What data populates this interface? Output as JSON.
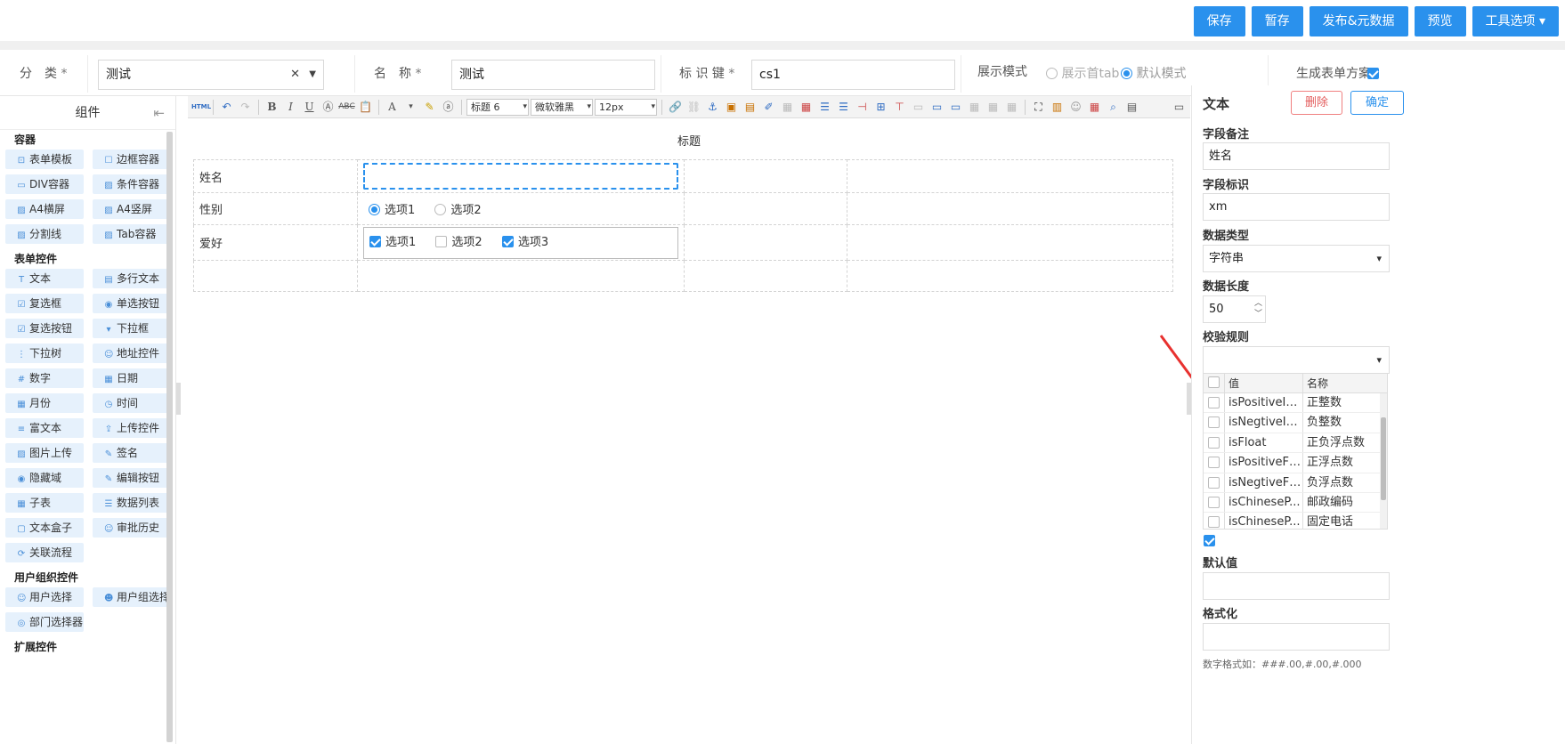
{
  "toolbar": {
    "buttons": [
      "保存",
      "暂存",
      "发布&元数据",
      "预览",
      "工具选项 ▾"
    ]
  },
  "meta": {
    "category_label": "分　类",
    "category_value": "测试",
    "name_label": "名　称",
    "name_value": "测试",
    "key_label": "标 识 键",
    "key_value": "cs1",
    "required_mark": "*",
    "display_mode_label": "展示模式",
    "display_mode_options": [
      "展示首tab",
      "默认模式"
    ],
    "display_mode_selected": "默认模式",
    "generate_scheme_label": "生成表单方案",
    "generate_scheme_checked": true
  },
  "left_panel": {
    "title": "组件",
    "groups": [
      {
        "title": "容器",
        "items": [
          {
            "icon": "html-icon",
            "label": "表单模板"
          },
          {
            "icon": "square-icon",
            "label": "边框容器"
          },
          {
            "icon": "div-icon",
            "label": "DIV容器"
          },
          {
            "icon": "image-icon",
            "label": "条件容器"
          },
          {
            "icon": "image-icon",
            "label": "A4横屏"
          },
          {
            "icon": "image-icon",
            "label": "A4竖屏"
          },
          {
            "icon": "image-icon",
            "label": "分割线"
          },
          {
            "icon": "image-icon",
            "label": "Tab容器"
          }
        ]
      },
      {
        "title": "表单控件",
        "items": [
          {
            "icon": "text-icon",
            "label": "文本"
          },
          {
            "icon": "textarea-icon",
            "label": "多行文本"
          },
          {
            "icon": "checkbox-icon",
            "label": "复选框"
          },
          {
            "icon": "radio-icon",
            "label": "单选按钮"
          },
          {
            "icon": "checkbox-icon",
            "label": "复选按钮"
          },
          {
            "icon": "dropdown-icon",
            "label": "下拉框"
          },
          {
            "icon": "tree-icon",
            "label": "下拉树"
          },
          {
            "icon": "user-icon",
            "label": "地址控件"
          },
          {
            "icon": "number-icon",
            "label": "数字"
          },
          {
            "icon": "calendar-icon",
            "label": "日期"
          },
          {
            "icon": "calendar-icon",
            "label": "月份"
          },
          {
            "icon": "clock-icon",
            "label": "时间"
          },
          {
            "icon": "richtext-icon",
            "label": "富文本"
          },
          {
            "icon": "upload-icon",
            "label": "上传控件"
          },
          {
            "icon": "image-icon",
            "label": "图片上传"
          },
          {
            "icon": "pen-icon",
            "label": "签名"
          },
          {
            "icon": "eye-icon",
            "label": "隐藏域"
          },
          {
            "icon": "edit-icon",
            "label": "编辑按钮"
          },
          {
            "icon": "table-icon",
            "label": "子表"
          },
          {
            "icon": "list-icon",
            "label": "数据列表"
          },
          {
            "icon": "box-icon",
            "label": "文本盒子"
          },
          {
            "icon": "user-icon",
            "label": "审批历史"
          },
          {
            "icon": "flow-icon",
            "label": "关联流程"
          }
        ]
      },
      {
        "title": "用户组织控件",
        "items": [
          {
            "icon": "user-icon",
            "label": "用户选择"
          },
          {
            "icon": "users-icon",
            "label": "用户组选择"
          },
          {
            "icon": "dept-icon",
            "label": "部门选择器"
          }
        ]
      },
      {
        "title": "扩展控件",
        "items": []
      }
    ]
  },
  "editor": {
    "heading_select": "标题 6",
    "font_select": "微软雅黑",
    "size_select": "12px",
    "html_label": "HTML",
    "font_color_label": "A"
  },
  "canvas": {
    "title": "标题",
    "rows": [
      {
        "label": "姓名"
      },
      {
        "label": "性别",
        "options": [
          "选项1",
          "选项2"
        ],
        "selected": 0
      },
      {
        "label": "爱好",
        "options": [
          "选项1",
          "选项2",
          "选项3"
        ],
        "checked": [
          true,
          false,
          true
        ]
      },
      {
        "label": ""
      }
    ]
  },
  "props": {
    "title": "文本",
    "delete_label": "删除",
    "confirm_label": "确定",
    "field_remark_label": "字段备注",
    "field_remark_value": "姓名",
    "field_key_label": "字段标识",
    "field_key_value": "xm",
    "data_type_label": "数据类型",
    "data_type_value": "字符串",
    "data_length_label": "数据长度",
    "data_length_value": "50",
    "validate_label": "校验规则",
    "validate_value": "",
    "rule_columns": [
      "值",
      "名称"
    ],
    "rules": [
      {
        "value": "isPositiveIn...",
        "name": "正整数"
      },
      {
        "value": "isNegtiveIn...",
        "name": "负整数"
      },
      {
        "value": "isFloat",
        "name": "正负浮点数"
      },
      {
        "value": "isPositiveFl...",
        "name": "正浮点数"
      },
      {
        "value": "isNegtiveFl...",
        "name": "负浮点数"
      },
      {
        "value": "isChineseP...",
        "name": "邮政编码"
      },
      {
        "value": "isChineseP...",
        "name": "固定电话"
      }
    ],
    "default_value_label": "默认值",
    "default_value": "",
    "format_label": "格式化",
    "format_value": "",
    "format_hint": "数字格式如：###.00,#.00,#.000"
  },
  "colors": {
    "primary": "#2a91ed",
    "danger": "#e35b5b",
    "annotation_arrow": "#e8312f"
  }
}
